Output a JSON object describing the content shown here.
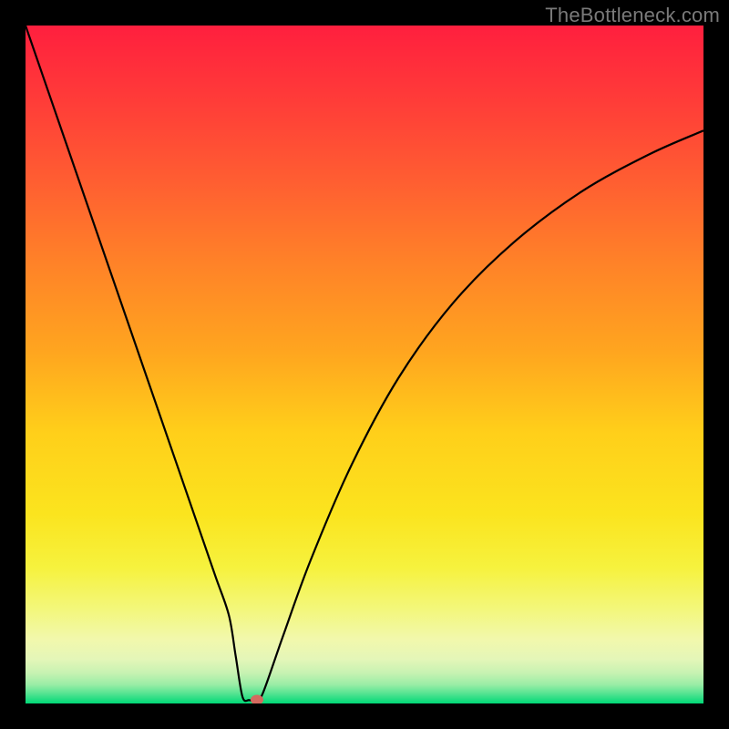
{
  "watermark": "TheBottleneck.com",
  "chart_data": {
    "type": "line",
    "title": "",
    "xlabel": "",
    "ylabel": "",
    "xlim": [
      0,
      100
    ],
    "ylim": [
      0,
      100
    ],
    "series": [
      {
        "name": "bottleneck-curve",
        "x": [
          0,
          5,
          10,
          15,
          20,
          25,
          28,
          30,
          31,
          32,
          33,
          34,
          35,
          38,
          42,
          48,
          55,
          63,
          72,
          82,
          92,
          100
        ],
        "values": [
          100,
          85.5,
          71,
          56.5,
          42,
          27.5,
          18.8,
          13.0,
          7.0,
          1.0,
          0.5,
          0.5,
          1.5,
          10,
          21,
          35,
          48,
          59,
          68,
          75.5,
          81,
          84.5
        ]
      }
    ],
    "gradient_stops": [
      {
        "offset": 0,
        "color": "#ff1f3e"
      },
      {
        "offset": 0.1,
        "color": "#ff3939"
      },
      {
        "offset": 0.22,
        "color": "#ff5b32"
      },
      {
        "offset": 0.35,
        "color": "#ff8228"
      },
      {
        "offset": 0.48,
        "color": "#ffa51f"
      },
      {
        "offset": 0.6,
        "color": "#ffcf1a"
      },
      {
        "offset": 0.72,
        "color": "#fbe41e"
      },
      {
        "offset": 0.8,
        "color": "#f6f23e"
      },
      {
        "offset": 0.86,
        "color": "#f3f77a"
      },
      {
        "offset": 0.905,
        "color": "#f2f8ac"
      },
      {
        "offset": 0.935,
        "color": "#e4f6b8"
      },
      {
        "offset": 0.955,
        "color": "#c7f2b2"
      },
      {
        "offset": 0.972,
        "color": "#9aeda6"
      },
      {
        "offset": 0.985,
        "color": "#57e492"
      },
      {
        "offset": 1.0,
        "color": "#00d977"
      }
    ],
    "marker": {
      "x": 34.1,
      "y": 0.5,
      "color": "#d46a5f"
    }
  }
}
